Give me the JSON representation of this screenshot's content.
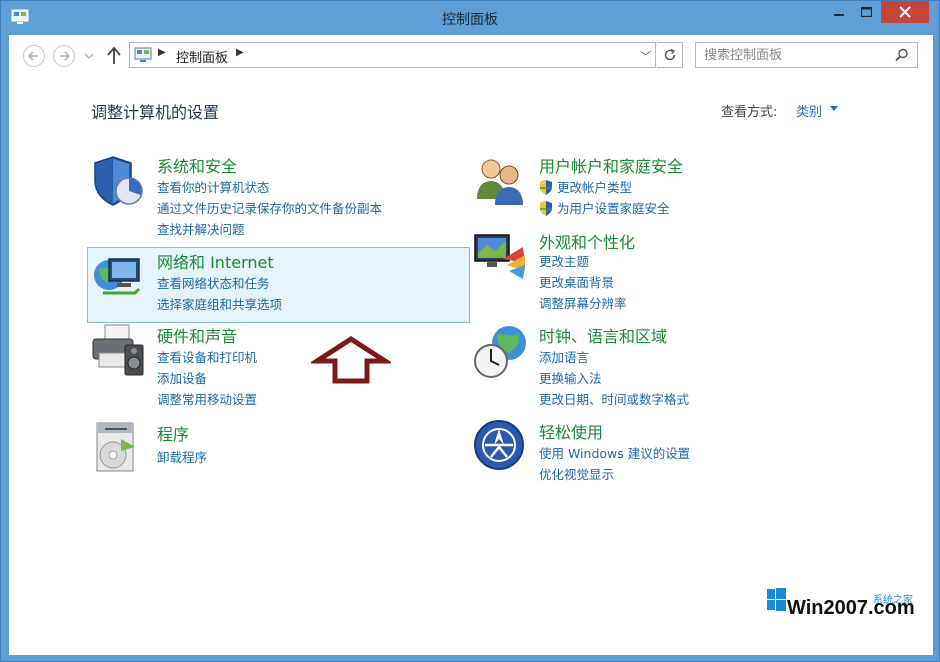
{
  "window": {
    "title": "控制面板",
    "close_color": "#c7463c",
    "frame_color": "#5e9ed6"
  },
  "nav": {
    "back_icon": "back-arrow-icon",
    "forward_icon": "forward-arrow-icon",
    "breadcrumb": "控制面板",
    "search_placeholder": "搜索控制面板"
  },
  "header": {
    "title": "调整计算机的设置",
    "view_by_label": "查看方式:",
    "view_by_value": "类别"
  },
  "categories": [
    {
      "title": "系统和安全",
      "icon": "shield-icon",
      "links": [
        "查看你的计算机状态",
        "通过文件历史记录保存你的文件备份副本",
        "查找并解决问题"
      ]
    },
    {
      "title": "网络和 Internet",
      "icon": "network-globe-icon",
      "links": [
        "查看网络状态和任务",
        "选择家庭组和共享选项"
      ]
    },
    {
      "title": "硬件和声音",
      "icon": "printer-icon",
      "links": [
        "查看设备和打印机",
        "添加设备",
        "调整常用移动设置"
      ]
    },
    {
      "title": "程序",
      "icon": "programs-icon",
      "links": [
        "卸载程序"
      ]
    },
    {
      "title": "用户帐户和家庭安全",
      "icon": "users-icon",
      "links": [
        "更改帐户类型",
        "为用户设置家庭安全"
      ]
    },
    {
      "title": "外观和个性化",
      "icon": "monitor-palette-icon",
      "links": [
        "更改主题",
        "更改桌面背景",
        "调整屏幕分辨率"
      ]
    },
    {
      "title": "时钟、语言和区域",
      "icon": "clock-globe-icon",
      "links": [
        "添加语言",
        "更换输入法",
        "更改日期、时间或数字格式"
      ]
    },
    {
      "title": "轻松使用",
      "icon": "ease-of-access-icon",
      "links": [
        "使用 Windows 建议的设置",
        "优化视觉显示"
      ]
    }
  ],
  "watermark": {
    "text": "Win2007.com",
    "subtext": "系统之家"
  },
  "colors": {
    "category_title": "#1a8b32",
    "link": "#1a6aa8",
    "highlight_bg": "#e5f3fb",
    "annotation_arrow": "#7a1a1a"
  }
}
